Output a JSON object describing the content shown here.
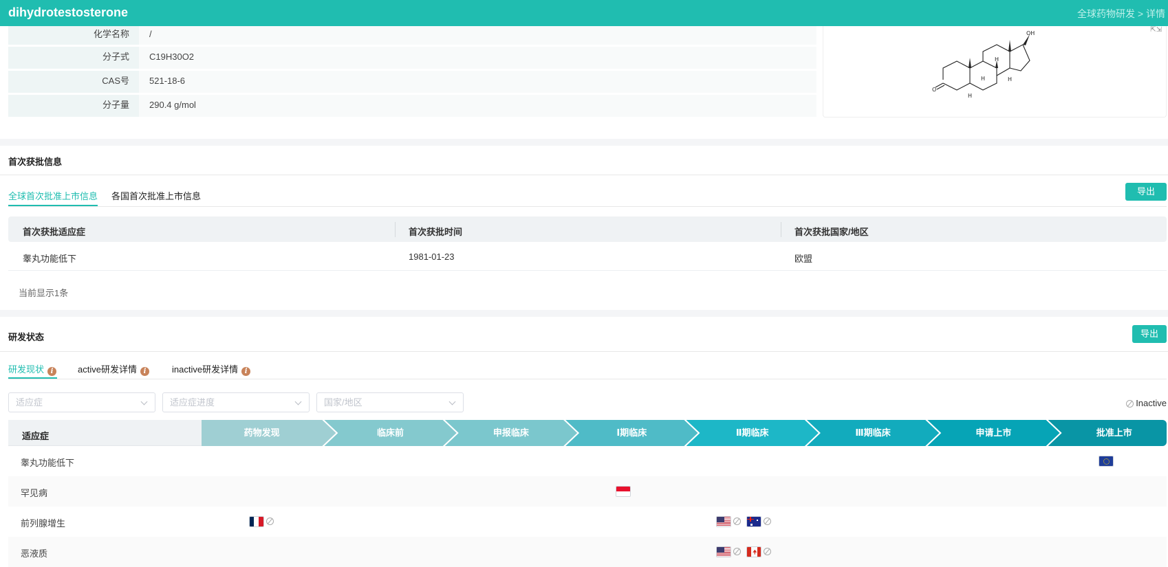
{
  "header": {
    "title": "dihydrotestosterone",
    "breadcrumb": "全球药物研发 > 详情"
  },
  "basic_info": [
    {
      "label": "化学名称",
      "value": "/"
    },
    {
      "label": "分子式",
      "value": "C19H30O2"
    },
    {
      "label": "CAS号",
      "value": "521-18-6"
    },
    {
      "label": "分子量",
      "value": "290.4 g/mol"
    }
  ],
  "structure": {
    "labels": {
      "oh": "OH",
      "o": "O",
      "h": "H"
    },
    "expand_icon": "expand-icon"
  },
  "first_approval": {
    "title": "首次获批信息",
    "tabs": [
      "全球首次批准上市信息",
      "各国首次批准上市信息"
    ],
    "export": "导出",
    "columns": [
      "首次获批适应症",
      "首次获批时间",
      "首次获批国家/地区"
    ],
    "rows": [
      [
        "睾丸功能低下",
        "1981-01-23",
        "欧盟"
      ]
    ],
    "footer": "当前显示1条"
  },
  "rd_status": {
    "title": "研发状态",
    "export": "导出",
    "tabs": [
      "研发现状",
      "active研发详情",
      "inactive研发详情"
    ],
    "filters": [
      {
        "placeholder": "适应症"
      },
      {
        "placeholder": "适应症进度"
      },
      {
        "placeholder": "国家/地区"
      }
    ],
    "legend_inactive": "Inactive",
    "indication_header": "适应症",
    "stages": [
      "药物发现",
      "临床前",
      "申报临床",
      "Ⅰ期临床",
      "Ⅱ期临床",
      "Ⅲ期临床",
      "申请上市",
      "批准上市"
    ],
    "stage_colors": [
      "#9fcfd3",
      "#84c9ce",
      "#7bc7cd",
      "#4fbbc7",
      "#1db7c7",
      "#12abbd",
      "#06a4b6",
      "#0995a5"
    ],
    "rows": [
      {
        "indication": "睾丸功能低下",
        "entries": [
          {
            "stage": 8,
            "country": "EU",
            "inactive": false
          }
        ]
      },
      {
        "indication": "罕见病",
        "entries": [
          {
            "stage": 4,
            "country": "ID",
            "inactive": false
          }
        ]
      },
      {
        "indication": "前列腺增生",
        "entries": [
          {
            "stage": 1,
            "country": "FR",
            "inactive": true
          },
          {
            "stage": 5,
            "country": "US",
            "inactive": true
          },
          {
            "stage": 5,
            "country": "AU",
            "inactive": true
          }
        ]
      },
      {
        "indication": "恶液质",
        "entries": [
          {
            "stage": 5,
            "country": "US",
            "inactive": true
          },
          {
            "stage": 5,
            "country": "CA",
            "inactive": true
          }
        ]
      }
    ]
  }
}
